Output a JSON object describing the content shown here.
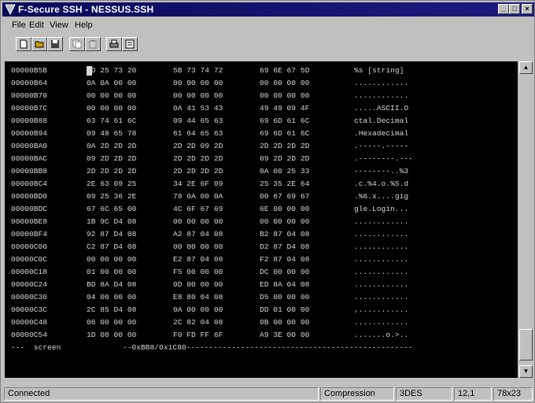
{
  "window": {
    "title": "F-Secure SSH - NESSUS.SSH"
  },
  "menu": {
    "items": [
      {
        "label": "File"
      },
      {
        "label": "Edit"
      },
      {
        "label": "View"
      },
      {
        "label": "Help"
      }
    ]
  },
  "terminal": {
    "rows": [
      {
        "addr": "00000B5B",
        "g1": "0D 25 73 20",
        "g2": "5B 73 74 72",
        "g3": "69 6E 67 5D",
        "ascii": "%s [string]"
      },
      {
        "addr": "00000B64",
        "g1": "0A 0A 00 00",
        "g2": "00 00 00 00",
        "g3": "00 00 00 00",
        "ascii": "............"
      },
      {
        "addr": "00000B70",
        "g1": "00 00 00 00",
        "g2": "00 00 00 00",
        "g3": "00 00 00 00",
        "ascii": "............"
      },
      {
        "addr": "00000B7C",
        "g1": "00 00 00 00",
        "g2": "0A 41 53 43",
        "g3": "49 49 09 4F",
        "ascii": ".....ASCII.O"
      },
      {
        "addr": "00000B88",
        "g1": "63 74 61 6C",
        "g2": "09 44 65 63",
        "g3": "69 6D 61 6C",
        "ascii": "ctal.Decimal"
      },
      {
        "addr": "00000B94",
        "g1": "09 48 65 78",
        "g2": "61 64 65 63",
        "g3": "69 6D 61 6C",
        "ascii": ".Hexadecimal"
      },
      {
        "addr": "00000BA0",
        "g1": "0A 2D 2D 2D",
        "g2": "2D 2D 09 2D",
        "g3": "2D 2D 2D 2D",
        "ascii": ".-----.-----"
      },
      {
        "addr": "00000BAC",
        "g1": "09 2D 2D 2D",
        "g2": "2D 2D 2D 2D",
        "g3": "09 2D 2D 2D",
        "ascii": ".--------.---"
      },
      {
        "addr": "00000BB8",
        "g1": "2D 2D 2D 2D",
        "g2": "2D 2D 2D 2D",
        "g3": "0A 00 25 33",
        "ascii": "--------..%3"
      },
      {
        "addr": "00000BC4",
        "g1": "2E 63 09 25",
        "g2": "34 2E 6F 09",
        "g3": "25 35 2E 64",
        "ascii": ".c.%4.o.%5.d"
      },
      {
        "addr": "00000BD0",
        "g1": "09 25 36 2E",
        "g2": "78 0A 00 0A",
        "g3": "00 67 69 67",
        "ascii": ".%6.x....gig"
      },
      {
        "addr": "00000BDC",
        "g1": "67 6C 65 00",
        "g2": "4C 6F 67 69",
        "g3": "6E 00 00 00",
        "ascii": "gle.Login..."
      },
      {
        "addr": "00000BE8",
        "g1": "1B 9C D4 08",
        "g2": "00 00 00 00",
        "g3": "00 00 00 00",
        "ascii": "............"
      },
      {
        "addr": "00000BF4",
        "g1": "92 87 D4 08",
        "g2": "A2 87 04 08",
        "g3": "B2 87 04 08",
        "ascii": "............"
      },
      {
        "addr": "00000C00",
        "g1": "C2 87 D4 08",
        "g2": "00 00 00 00",
        "g3": "D2 87 D4 08",
        "ascii": "............"
      },
      {
        "addr": "00000C0C",
        "g1": "00 00 00 00",
        "g2": "E2 87 04 08",
        "g3": "F2 87 04 08",
        "ascii": "............"
      },
      {
        "addr": "00000C18",
        "g1": "01 00 00 00",
        "g2": "F5 00 00 00",
        "g3": "DC 00 00 00",
        "ascii": "............"
      },
      {
        "addr": "00000C24",
        "g1": "BD 8A D4 08",
        "g2": "0D 00 00 00",
        "g3": "ED 8A 04 08",
        "ascii": "............"
      },
      {
        "addr": "00000C30",
        "g1": "04 00 00 00",
        "g2": "E8 80 04 08",
        "g3": "D5 00 00 00",
        "ascii": "............"
      },
      {
        "addr": "00000C3C",
        "g1": "2C 85 D4 08",
        "g2": "0A 00 00 00",
        "g3": "DD 01 00 00",
        "ascii": ",..........."
      },
      {
        "addr": "00000C48",
        "g1": "06 00 00 00",
        "g2": "2C 82 04 08",
        "g3": "0B 00 00 00",
        "ascii": "............"
      },
      {
        "addr": "00000C54",
        "g1": "1D 00 00 00",
        "g2": "F0 FD FF 6F",
        "g3": "A9 3E 00 00",
        "ascii": ".......o.>.."
      }
    ],
    "footer_left": "---  screen",
    "footer_mid": "--0xBB8/0x1C80--------------------------------------------------"
  },
  "status": {
    "connection": "Connected",
    "compression": "Compression",
    "cipher": "3DES",
    "position": "12,1",
    "size": "78x23"
  },
  "icons": [
    "app-icon",
    "minimize-icon",
    "maximize-icon",
    "close-icon",
    "new-icon",
    "open-icon",
    "save-icon",
    "copy-icon",
    "paste-icon",
    "print-icon",
    "properties-icon",
    "scroll-up-icon",
    "scroll-down-icon"
  ],
  "colors": {
    "titlebar": "#0a0a5a",
    "terminal_bg": "#000000",
    "terminal_fg": "#d8d8d8",
    "chrome": "#c0c0c0"
  }
}
